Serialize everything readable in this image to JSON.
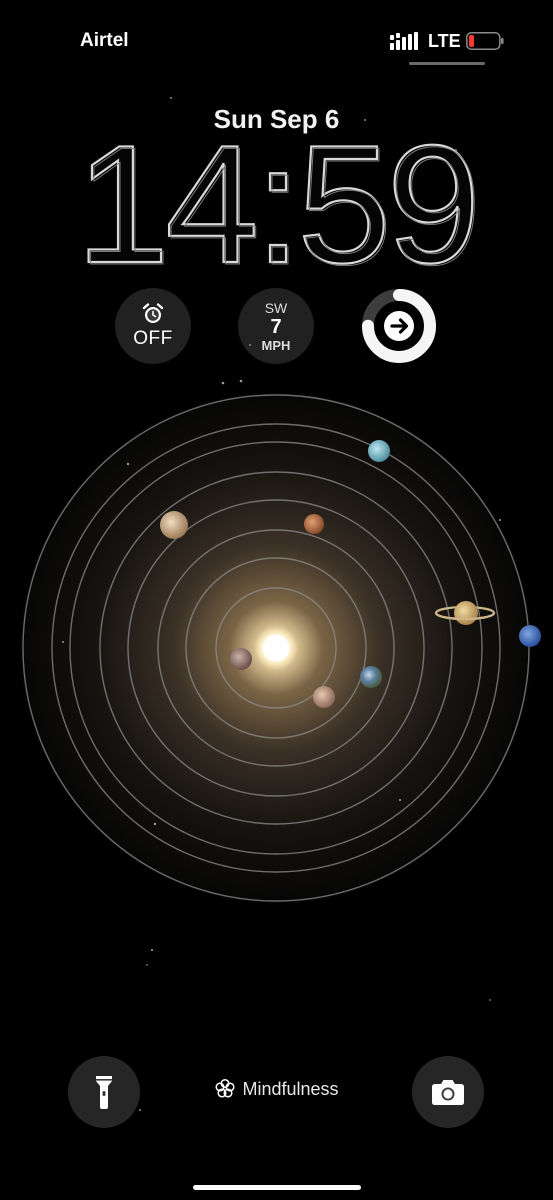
{
  "status": {
    "carrier": "Airtel",
    "network": "LTE",
    "battery_color": "#ff3b30"
  },
  "lock": {
    "date": "Sun Sep 6",
    "time": "14:59"
  },
  "widgets": {
    "alarm": {
      "icon": "alarm-clock-icon",
      "label": "OFF"
    },
    "wind": {
      "direction": "SW",
      "speed": "7",
      "unit": "MPH"
    },
    "activity": {
      "icon": "arrow-right-icon",
      "ring_fraction": 0.75
    }
  },
  "bottom": {
    "flashlight_icon": "flashlight-icon",
    "mindfulness_label": "Mindfulness",
    "camera_icon": "camera-icon"
  },
  "wallpaper": {
    "type": "solar-system",
    "planets": [
      "mercury",
      "venus",
      "earth",
      "mars",
      "jupiter",
      "saturn",
      "uranus",
      "neptune"
    ]
  }
}
